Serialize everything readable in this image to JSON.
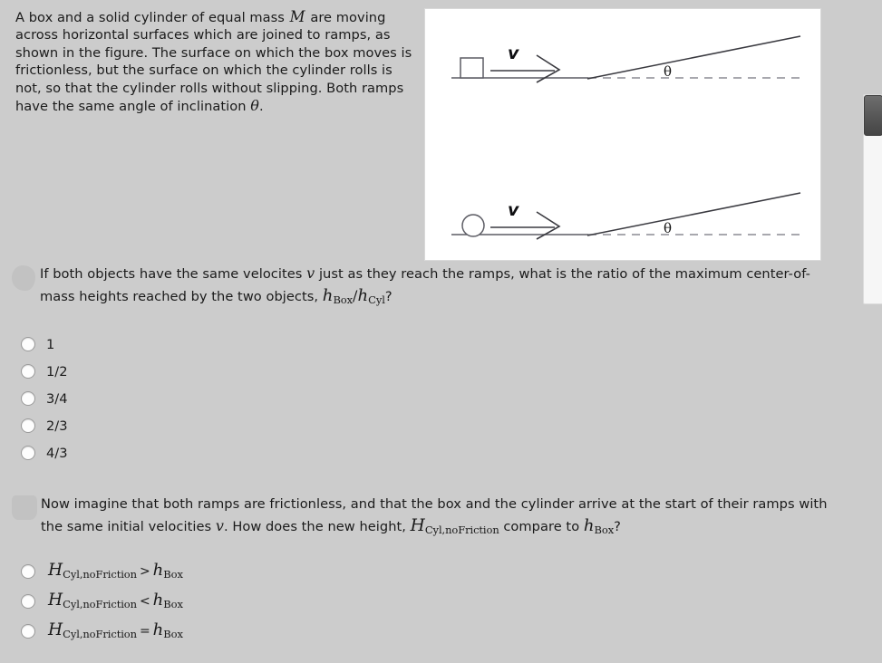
{
  "problem": {
    "text_line_1": "A box and a solid cylinder of equal mass",
    "mass_symbol": "M",
    "text_line_1b": "are moving",
    "text_body": "across horizontal surfaces which are joined to ramps, as shown in the figure.  The surface on which the box moves is frictionless, but the surface on which the cylinder rolls is not, so that the cylinder rolls without slipping.  Both ramps have the same angle of inclination",
    "theta_symbol": "θ",
    "period": "."
  },
  "figure": {
    "velocity_label": "v",
    "angle_label": "θ",
    "top_object": "box",
    "bottom_object": "cylinder"
  },
  "question_1": {
    "text_a": "If both objects have the same velocites",
    "velocity_symbol": "v",
    "text_b": "just as they reach the ramps, what is the ratio of the maximum center-of-mass heights reached by the two objects,",
    "ratio_numerator_base": "h",
    "ratio_numerator_sub": "Box",
    "ratio_slash": "/",
    "ratio_denominator_base": "h",
    "ratio_denominator_sub": "Cyl",
    "question_mark": "?",
    "options": [
      {
        "label": "1"
      },
      {
        "label": "1/2"
      },
      {
        "label": "3/4"
      },
      {
        "label": "2/3"
      },
      {
        "label": "4/3"
      }
    ]
  },
  "question_2": {
    "text_a": "Now imagine that both ramps are frictionless, and that the box and the cylinder arrive at the start of their ramps with the same initial velocities",
    "velocity_symbol": "v",
    "text_b": ". How does the new height,",
    "height_base": "H",
    "height_sub": "Cyl,noFriction",
    "text_c": "compare to",
    "compare_base": "h",
    "compare_sub": "Box",
    "question_mark": "?",
    "options": [
      {
        "lhs_base": "H",
        "lhs_sub": "Cyl,noFriction",
        "operator": ">",
        "rhs_base": "h",
        "rhs_sub": "Box"
      },
      {
        "lhs_base": "H",
        "lhs_sub": "Cyl,noFriction",
        "operator": "<",
        "rhs_base": "h",
        "rhs_sub": "Box"
      },
      {
        "lhs_base": "H",
        "lhs_sub": "Cyl,noFriction",
        "operator": "=",
        "rhs_base": "h",
        "rhs_sub": "Box"
      }
    ]
  },
  "colors": {
    "page_background": "#cccccc",
    "panel_background": "#ffffff",
    "text": "#1a1a1a",
    "scrollbar_thumb": "#555555",
    "scrollbar_track": "#f6f6f6"
  }
}
